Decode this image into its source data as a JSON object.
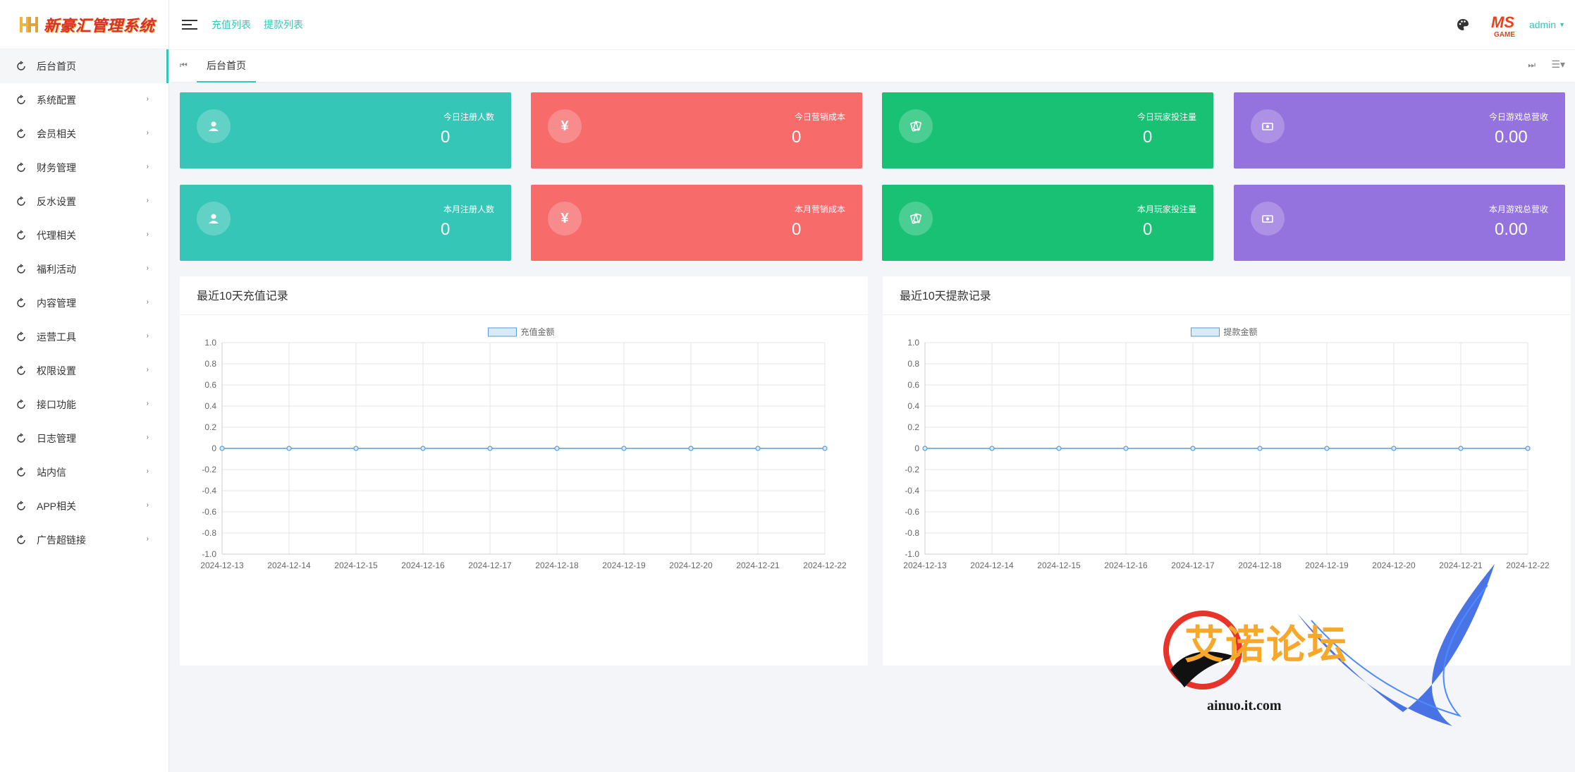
{
  "app": {
    "logo_text": "新豪汇管理系统"
  },
  "header": {
    "links": [
      "充值列表",
      "提款列表"
    ],
    "user": "admin",
    "avatar_badge": "MS",
    "avatar_sub": "GAME"
  },
  "sidebar": {
    "items": [
      {
        "label": "后台首页",
        "active": true
      },
      {
        "label": "系统配置"
      },
      {
        "label": "会员相关"
      },
      {
        "label": "财务管理"
      },
      {
        "label": "反水设置"
      },
      {
        "label": "代理相关"
      },
      {
        "label": "福利活动"
      },
      {
        "label": "内容管理"
      },
      {
        "label": "运营工具"
      },
      {
        "label": "权限设置"
      },
      {
        "label": "接口功能"
      },
      {
        "label": "日志管理"
      },
      {
        "label": "站内信"
      },
      {
        "label": "APP相关"
      },
      {
        "label": "广告超链接"
      }
    ]
  },
  "tabs": {
    "active": "后台首页"
  },
  "stats": {
    "today": [
      {
        "label": "今日注册人数",
        "value": "0",
        "icon": "user-icon",
        "color": "#36c6b8"
      },
      {
        "label": "今日营销成本",
        "value": "0",
        "icon": "yen-icon",
        "color": "#f76b6b"
      },
      {
        "label": "今日玩家投注量",
        "value": "0",
        "icon": "cards-icon",
        "color": "#19c174"
      },
      {
        "label": "今日游戏总营收",
        "value": "0.00",
        "icon": "money-icon",
        "color": "#9573de"
      }
    ],
    "month": [
      {
        "label": "本月注册人数",
        "value": "0",
        "icon": "user-icon",
        "color": "#36c6b8"
      },
      {
        "label": "本月营销成本",
        "value": "0",
        "icon": "yen-icon",
        "color": "#f76b6b"
      },
      {
        "label": "本月玩家投注量",
        "value": "0",
        "icon": "cards-icon",
        "color": "#19c174"
      },
      {
        "label": "本月游戏总营收",
        "value": "0.00",
        "icon": "money-icon",
        "color": "#9573de"
      }
    ]
  },
  "panels": {
    "recharge_title": "最近10天充值记录",
    "withdraw_title": "最近10天提款记录"
  },
  "chart_data": [
    {
      "type": "line",
      "title": "最近10天充值记录",
      "x": [
        "2024-12-13",
        "2024-12-14",
        "2024-12-15",
        "2024-12-16",
        "2024-12-17",
        "2024-12-18",
        "2024-12-19",
        "2024-12-20",
        "2024-12-21",
        "2024-12-22"
      ],
      "series": [
        {
          "name": "充值金额",
          "values": [
            0,
            0,
            0,
            0,
            0,
            0,
            0,
            0,
            0,
            0
          ]
        }
      ],
      "ylim": [
        -1.0,
        1.0
      ],
      "yticks": [
        "1.0",
        "0.8",
        "0.6",
        "0.4",
        "0.2",
        "0",
        "-0.2",
        "-0.4",
        "-0.6",
        "-0.8",
        "-1.0"
      ],
      "grid": true,
      "legend": "top-center"
    },
    {
      "type": "line",
      "title": "最近10天提款记录",
      "x": [
        "2024-12-13",
        "2024-12-14",
        "2024-12-15",
        "2024-12-16",
        "2024-12-17",
        "2024-12-18",
        "2024-12-19",
        "2024-12-20",
        "2024-12-21",
        "2024-12-22"
      ],
      "series": [
        {
          "name": "提款金额",
          "values": [
            0,
            0,
            0,
            0,
            0,
            0,
            0,
            0,
            0,
            0
          ]
        }
      ],
      "ylim": [
        -1.0,
        1.0
      ],
      "yticks": [
        "1.0",
        "0.8",
        "0.6",
        "0.4",
        "0.2",
        "0",
        "-0.2",
        "-0.4",
        "-0.6",
        "-0.8",
        "-1.0"
      ],
      "grid": true,
      "legend": "top-center"
    }
  ],
  "watermark": {
    "text": "艾诺论坛",
    "url": "ainuo.it.com"
  },
  "colors": {
    "accent": "#36c6b8",
    "line": "#5b9bd5"
  }
}
